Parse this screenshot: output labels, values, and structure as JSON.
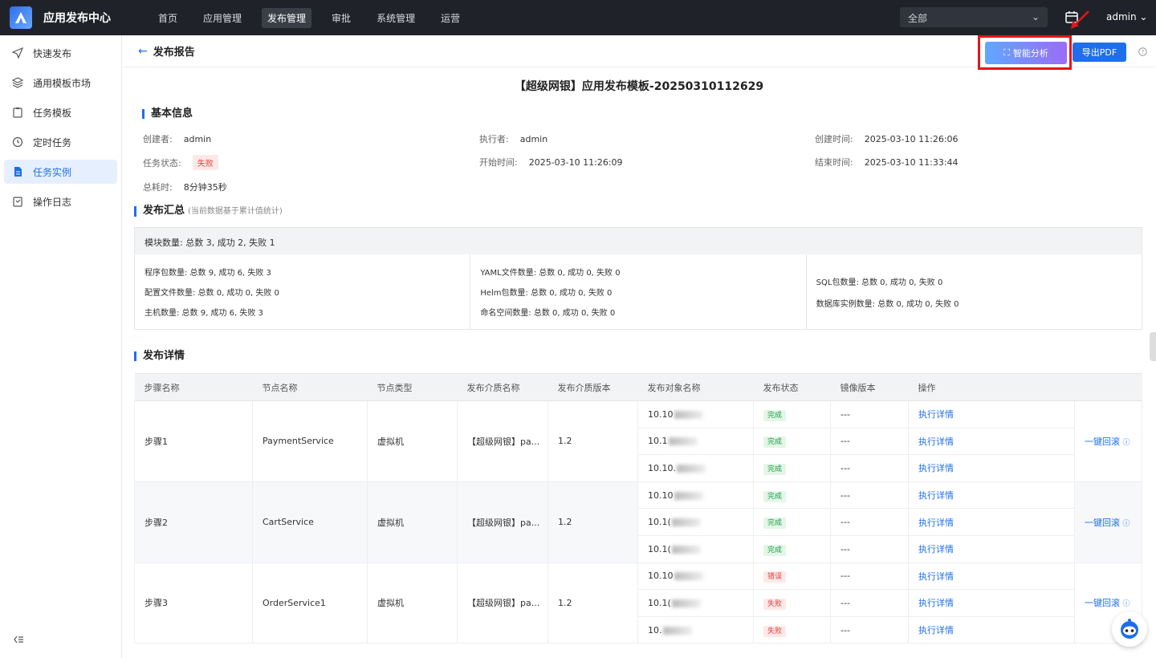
{
  "app": {
    "title": "应用发布中心"
  },
  "nav": [
    "首页",
    "应用管理",
    "发布管理",
    "审批",
    "系统管理",
    "运营"
  ],
  "scope": "全部",
  "user": "admin",
  "sidebar": [
    "快速发布",
    "通用模板市场",
    "任务模板",
    "定时任务",
    "任务实例",
    "操作日志"
  ],
  "page": {
    "title": "发布报告",
    "ai_button": "智能分析",
    "pdf_button": "导出PDF"
  },
  "report_title": "【超级网银】应用发布模板-20250310112629",
  "basic": {
    "title": "基本信息",
    "creator_l": "创建者:",
    "creator": "admin",
    "executor_l": "执行者:",
    "executor": "admin",
    "created_l": "创建时间:",
    "created": "2025-03-10 11:26:06",
    "status_l": "任务状态:",
    "status": "失败",
    "start_l": "开始时间:",
    "start": "2025-03-10 11:26:09",
    "end_l": "结束时间:",
    "end": "2025-03-10 11:33:44",
    "dur_l": "总耗时:",
    "dur": "8分钟35秒"
  },
  "summary": {
    "title": "发布汇总",
    "note": "(当前数据基于累计值统计)",
    "modules": "模块数量: 总数 3, 成功 2, 失败 1",
    "c1": [
      "程序包数量: 总数 9, 成功 6, 失败 3",
      "配置文件数量: 总数 0, 成功 0, 失败 0",
      "主机数量: 总数 9, 成功 6, 失败 3"
    ],
    "c2": [
      "YAML文件数量: 总数 0, 成功 0, 失败 0",
      "Helm包数量: 总数 0, 成功 0, 失败 0",
      "命名空间数量: 总数 0, 成功 0, 失败 0"
    ],
    "c3": [
      "SQL包数量: 总数 0, 成功 0, 失败 0",
      "数据库实例数量: 总数 0, 成功 0, 失败 0"
    ]
  },
  "detail": {
    "title": "发布详情",
    "headers": [
      "步骤名称",
      "节点名称",
      "节点类型",
      "发布介质名称",
      "发布介质版本",
      "发布对象名称",
      "发布状态",
      "镜像版本",
      "操作",
      ""
    ],
    "exec_link": "执行详情",
    "rollback": "一键回滚",
    "mirror": "---",
    "steps": [
      {
        "name": "步骤1",
        "node": "PaymentService",
        "type": "虚拟机",
        "media": "【超级网银】pa...",
        "ver": "1.2",
        "targets": [
          "10.10",
          "10.1",
          "10.10."
        ],
        "status": [
          "完成",
          "完成",
          "完成"
        ]
      },
      {
        "name": "步骤2",
        "node": "CartService",
        "type": "虚拟机",
        "media": "【超级网银】pa...",
        "ver": "1.2",
        "targets": [
          "10.10",
          "10.1(",
          "10.1("
        ],
        "status": [
          "完成",
          "完成",
          "完成"
        ]
      },
      {
        "name": "步骤3",
        "node": "OrderService1",
        "type": "虚拟机",
        "media": "【超级网银】pa...",
        "ver": "1.2",
        "targets": [
          "10.10",
          "10.1(",
          "10."
        ],
        "status": [
          "错误",
          "失败",
          "失败"
        ]
      }
    ]
  },
  "colors": {
    "accent": "#1f6fea",
    "fail": "#e0443d",
    "ok": "#1e9c4a"
  }
}
